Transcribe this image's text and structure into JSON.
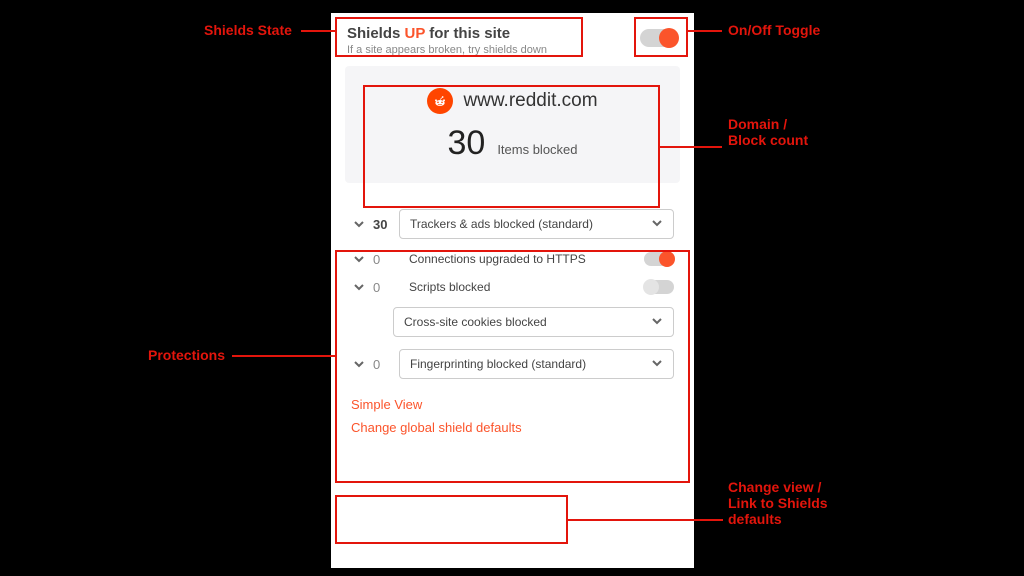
{
  "colors": {
    "accent": "#fb542b",
    "callout": "#e3150c"
  },
  "header": {
    "prefix": "Shields ",
    "state": "UP",
    "suffix": " for this site",
    "hint": "If a site appears broken, try shields down",
    "toggle_on": true
  },
  "domain_card": {
    "domain": "www.reddit.com",
    "blocked_count": "30",
    "blocked_label": "Items blocked"
  },
  "protections": {
    "trackers": {
      "count": "30",
      "label": "Trackers & ads blocked (standard)"
    },
    "https": {
      "count": "0",
      "label": "Connections upgraded to HTTPS",
      "toggle_on": true
    },
    "scripts": {
      "count": "0",
      "label": "Scripts blocked",
      "toggle_on": false
    },
    "cookies": {
      "label": "Cross-site cookies blocked"
    },
    "fingerprint": {
      "count": "0",
      "label": "Fingerprinting blocked (standard)"
    }
  },
  "footer": {
    "simple_view": "Simple View",
    "global_defaults": "Change global shield defaults"
  },
  "callouts": {
    "shields_state": "Shields State",
    "onoff": "On/Off Toggle",
    "domain_block": "Domain /\nBlock count",
    "protections": "Protections",
    "change_view": "Change view /\nLink to Shields\ndefaults"
  }
}
